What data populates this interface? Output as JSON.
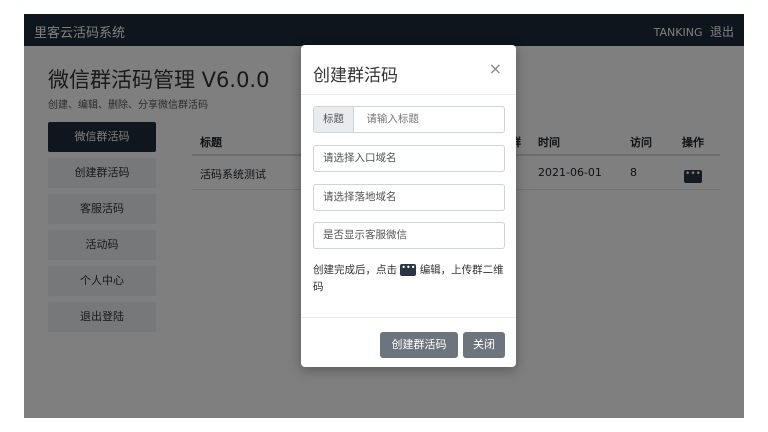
{
  "navbar": {
    "brand": "里客云活码系统",
    "user": "TANKING",
    "logout": "退出"
  },
  "header": {
    "title": "微信群活码管理 V6.0.0",
    "subtitle": "创建、编辑、删除、分享微信群活码"
  },
  "sidebar": {
    "items": [
      {
        "label": "微信群活码"
      },
      {
        "label": "创建群活码"
      },
      {
        "label": "客服活码"
      },
      {
        "label": "活动码"
      },
      {
        "label": "个人中心"
      },
      {
        "label": "退出登陆"
      }
    ]
  },
  "table": {
    "columns": [
      "标题",
      "群",
      "时间",
      "访问",
      "操作"
    ],
    "rows": [
      {
        "title": "活码系统测试",
        "time": "2021-06-01",
        "visits": "8",
        "action_icon": "more-icon"
      }
    ]
  },
  "modal": {
    "title": "创建群活码",
    "close": "×",
    "title_addon": "标题",
    "title_placeholder": "请输入标题",
    "entry_domain": "请选择入口域名",
    "landing_domain": "请选择落地域名",
    "show_service": "是否显示客服微信",
    "hint_before": "创建完成后，点击",
    "hint_after": "编辑，上传群二维码",
    "create_button": "创建群活码",
    "close_button": "关闭"
  },
  "icons": {
    "ellipsis": "•••",
    "close": "×"
  },
  "colors": {
    "navbar": "#1f2b3a",
    "active_nav": "#1f2d3d",
    "button": "#6c757d",
    "overlay": "rgba(0,0,0,0.5)"
  }
}
